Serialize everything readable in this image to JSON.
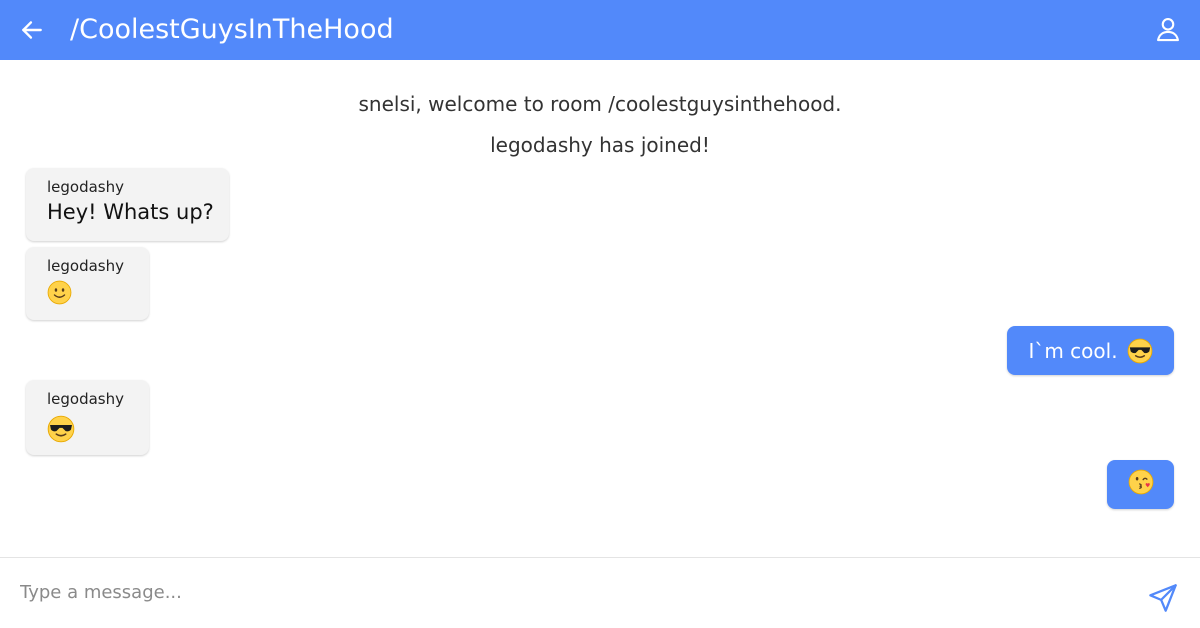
{
  "header": {
    "room_title": "/CoolestGuysInTheHood",
    "back_icon": "arrow-left-icon",
    "profile_icon": "user-icon",
    "background": "#5289fa"
  },
  "system_messages": [
    "snelsi, welcome to room /coolestguysinthehood.",
    "legodashy has joined!"
  ],
  "messages": [
    {
      "direction": "incoming",
      "sender": "legodashy",
      "text": "Hey! Whats up?"
    },
    {
      "direction": "incoming",
      "sender": "legodashy",
      "text": "",
      "emoji": "slightly-smiling-face"
    },
    {
      "direction": "outgoing",
      "text": "I`m cool.",
      "emoji": "sunglasses-face"
    },
    {
      "direction": "incoming",
      "sender": "legodashy",
      "text": "",
      "emoji": "sunglasses-face"
    },
    {
      "direction": "outgoing",
      "text": "",
      "emoji": "kissing-face"
    }
  ],
  "composer": {
    "placeholder": "Type a message...",
    "value": "",
    "send_icon": "send-icon"
  },
  "colors": {
    "accent": "#5289fa",
    "incoming_bubble": "#f3f3f3"
  }
}
